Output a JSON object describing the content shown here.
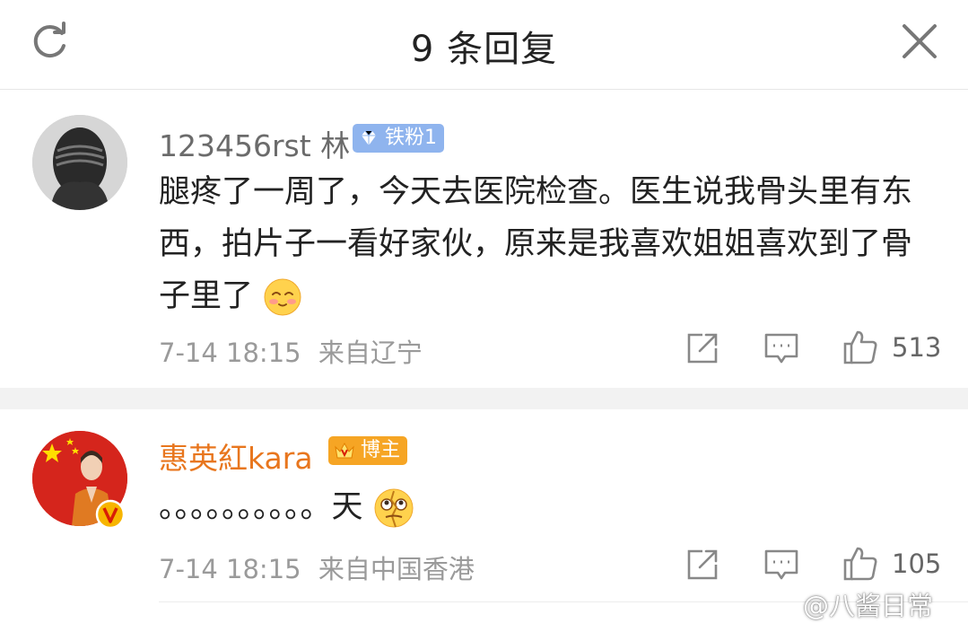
{
  "header": {
    "title": "9 条回复",
    "refresh_icon": "refresh-icon",
    "close_icon": "close-icon"
  },
  "comments": [
    {
      "username": "123456rst 林",
      "username_color": "#6b6b6b",
      "badge": {
        "label": "铁粉1",
        "icon": "diamond-icon",
        "color": "#8fb4ee"
      },
      "text": "腿疼了一周了，今天去医院检查。医生说我骨头里有东西，拍片子一看好家伙，原来是我喜欢姐姐喜欢到了骨子里了",
      "emoji": "shy-smile-emoji",
      "time": "7-14 18:15",
      "location": "来自辽宁",
      "likes": "513"
    },
    {
      "username": "惠英紅kara",
      "username_color": "#e8761e",
      "badge": {
        "label": "博主",
        "icon": "crown-icon",
        "color": "#f6a524"
      },
      "text": "。。。。。。。。。。天",
      "emoji": "cracked-face-emoji",
      "time": "7-14 18:15",
      "location": "来自中国香港",
      "likes": "105"
    }
  ],
  "watermark": "@八酱日常",
  "colors": {
    "divider": "#f2f2f2",
    "meta": "#9a9a9a",
    "icon": "#8a8a8a"
  }
}
